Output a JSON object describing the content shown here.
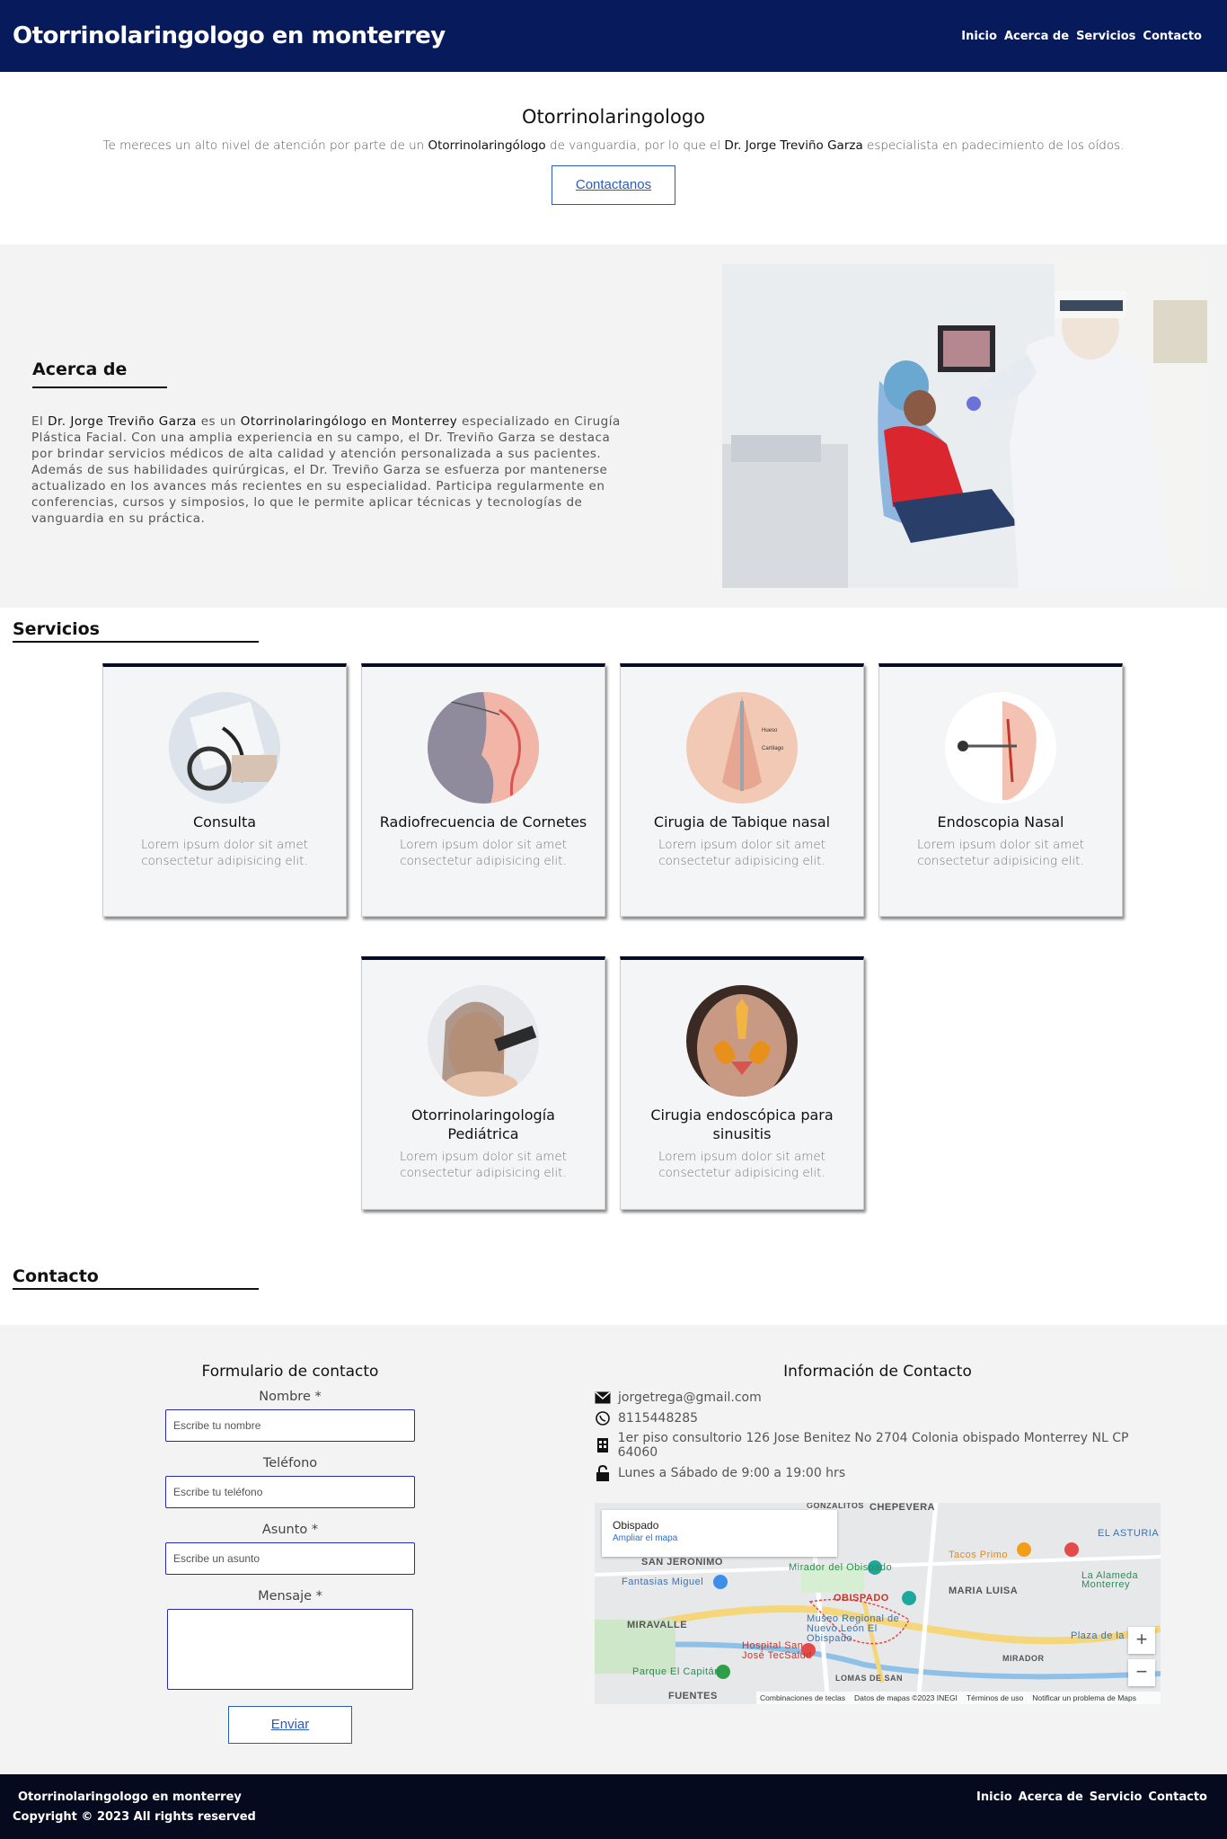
{
  "header": {
    "brand": "Otorrinolaringologo en monterrey",
    "nav": [
      "Inicio",
      "Acerca de",
      "Servicios",
      "Contacto"
    ]
  },
  "hero": {
    "title": "Otorrinolaringologo",
    "text_1": "Te mereces un alto nivel de atención por parte de un ",
    "strong_1": "Otorrinolaringólogo",
    "text_2": " de vanguardia, por lo que el ",
    "strong_2": "Dr. Jorge Treviño Garza",
    "text_3": " especialista en padecimiento de los oídos.",
    "button": "Contactanos"
  },
  "about": {
    "title": "Acerca de",
    "p_1": "El ",
    "s_1": "Dr. Jorge Treviño Garza",
    "p_2": " es un ",
    "s_2": "Otorrinolaringólogo en Monterrey",
    "p_3": " especializado en Cirugía Plástica Facial. Con una amplia experiencia en su campo, el Dr. Treviño Garza se destaca por brindar servicios médicos de alta calidad y atención personalizada a sus pacientes. Además de sus habilidades quirúrgicas, el Dr. Treviño Garza se esfuerza por mantenerse actualizado en los avances más recientes en su especialidad. Participa regularmente en conferencias, cursos y simposios, lo que le permite aplicar técnicas y tecnologías de vanguardia en su práctica."
  },
  "services": {
    "title": "Servicios",
    "cards": [
      {
        "title": "Consulta",
        "desc": "Lorem ipsum dolor sit amet consectetur adipisicing elit."
      },
      {
        "title": "Radiofrecuencia de Cornetes",
        "desc": "Lorem ipsum dolor sit amet consectetur adipisicing elit."
      },
      {
        "title": "Cirugia de Tabique nasal",
        "desc": "Lorem ipsum dolor sit amet consectetur adipisicing elit."
      },
      {
        "title": "Endoscopia Nasal",
        "desc": "Lorem ipsum dolor sit amet consectetur adipisicing elit."
      },
      {
        "title": "Otorrinolaringología Pediátrica",
        "desc": "Lorem ipsum dolor sit amet consectetur adipisicing elit."
      },
      {
        "title": "Cirugia endoscópica para sinusitis",
        "desc": "Lorem ipsum dolor sit amet consectetur adipisicing elit."
      }
    ],
    "image_labels": {
      "hueso": "Hueso",
      "cartilago": "Cartílago"
    }
  },
  "contact": {
    "title": "Contacto",
    "form": {
      "title": "Formulario de contacto",
      "name_label": "Nombre *",
      "name_placeholder": "Escribe tu nombre",
      "phone_label": "Teléfono",
      "phone_placeholder": "Escribe tu teléfono",
      "subject_label": "Asunto *",
      "subject_placeholder": "Escribe un asunto",
      "message_label": "Mensaje *",
      "submit": "Enviar"
    },
    "info": {
      "title": "Información de Contacto",
      "email": "jorgetrega@gmail.com",
      "phone": "8115448285",
      "address": "1er piso consultorio 126 Jose Benitez No 2704 Colonia obispado Monterrey NL CP 64060",
      "hours": "Lunes a Sábado de 9:00 a 19:00 hrs"
    },
    "map": {
      "place": "Obispado",
      "link": "Ampliar el mapa",
      "labels": [
        "GONZALITOS",
        "CHEPEVERA",
        "SAN JERONIMO",
        "Mirador del Obispado",
        "Tacos Primo",
        "EL ASTURIA",
        "Fantasias Miguel",
        "OBISPADO",
        "MARIA LUISA",
        "La Alameda Monterrey",
        "MIRAVALLE",
        "Museo Regional de Nuevo León El Obispado",
        "Hospital San José TecSalud",
        "Plaza de la",
        "Parque El Capitán",
        "MIRADOR",
        "FUENTES",
        "LOMAS DE SAN"
      ],
      "footer": [
        "Combinaciones de teclas",
        "Datos de mapas ©2023 INEGI",
        "Términos de uso",
        "Notificar un problema de Maps"
      ]
    }
  },
  "footer": {
    "brand": "Otorrinolaringologo en monterrey",
    "copyright": "Copyright © 2023 All rights reserved",
    "nav": [
      "Inicio",
      "Acerca de",
      "Servicio",
      "Contacto"
    ]
  },
  "colors": {
    "header_bg": "#061a5c",
    "footer_bg": "#050a1e",
    "accent": "#2a5cbf",
    "card_border": "#050a25"
  }
}
